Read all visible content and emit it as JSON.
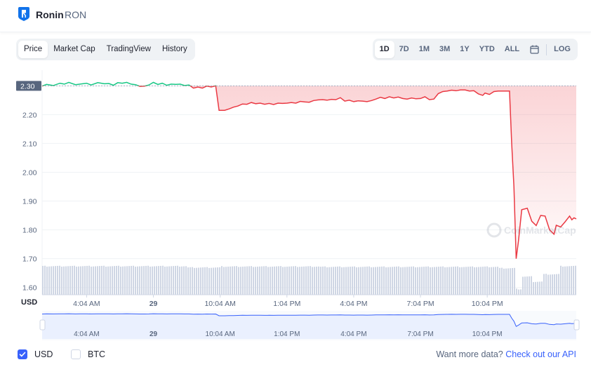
{
  "header": {
    "name": "Ronin",
    "symbol": "RON"
  },
  "tabs": [
    "Price",
    "Market Cap",
    "TradingView",
    "History"
  ],
  "ranges": [
    "1D",
    "7D",
    "1M",
    "3M",
    "1Y",
    "YTD",
    "ALL"
  ],
  "log_label": "LOG",
  "icons": {
    "logo": "ronin-logo-icon",
    "calendar": "calendar-icon",
    "check": "check-icon"
  },
  "colors": {
    "up": "#16c784",
    "down": "#ea3943",
    "accent": "#3861fb",
    "volume": "#cfd6e4"
  },
  "chart_data": {
    "type": "line",
    "ylabel": "USD",
    "y_ticks": [
      2.3,
      2.2,
      2.1,
      2.0,
      1.9,
      1.8,
      1.7,
      1.6
    ],
    "ylim": [
      1.575,
      2.33
    ],
    "x_ticks": [
      "4:04 AM",
      "29",
      "10:04 AM",
      "1:04 PM",
      "4:04 PM",
      "7:04 PM",
      "10:04 PM"
    ],
    "x_tick_hours": [
      2,
      5,
      8,
      11,
      14,
      17,
      20
    ],
    "x_range_hours": [
      0,
      24
    ],
    "reference_price": 2.3,
    "reference_label": "2.30",
    "grid": true,
    "watermark": "CoinMarketCap",
    "series": [
      {
        "values": [
          [
            0,
            2.299
          ],
          [
            0.2,
            2.305
          ],
          [
            0.5,
            2.301
          ],
          [
            0.8,
            2.309
          ],
          [
            1.0,
            2.306
          ],
          [
            1.2,
            2.312
          ],
          [
            1.5,
            2.304
          ],
          [
            1.7,
            2.306
          ],
          [
            2.0,
            2.309
          ],
          [
            2.2,
            2.303
          ],
          [
            2.5,
            2.311
          ],
          [
            2.8,
            2.307
          ],
          [
            3.0,
            2.308
          ],
          [
            3.2,
            2.302
          ],
          [
            3.4,
            2.311
          ],
          [
            3.6,
            2.309
          ],
          [
            3.8,
            2.312
          ],
          [
            4.0,
            2.306
          ],
          [
            4.2,
            2.304
          ],
          [
            4.4,
            2.298
          ],
          [
            4.6,
            2.299
          ],
          [
            4.8,
            2.303
          ],
          [
            5.0,
            2.312
          ],
          [
            5.2,
            2.305
          ],
          [
            5.4,
            2.309
          ],
          [
            5.6,
            2.302
          ],
          [
            5.8,
            2.306
          ],
          [
            6.0,
            2.305
          ],
          [
            6.2,
            2.306
          ],
          [
            6.4,
            2.301
          ],
          [
            6.6,
            2.303
          ],
          [
            6.8,
            2.292
          ],
          [
            7.0,
            2.296
          ],
          [
            7.2,
            2.292
          ],
          [
            7.4,
            2.299
          ],
          [
            7.6,
            2.296
          ],
          [
            7.8,
            2.3
          ],
          [
            7.95,
            2.215
          ],
          [
            8.2,
            2.215
          ],
          [
            8.4,
            2.22
          ],
          [
            8.6,
            2.226
          ],
          [
            8.8,
            2.23
          ],
          [
            9.0,
            2.237
          ],
          [
            9.2,
            2.236
          ],
          [
            9.4,
            2.242
          ],
          [
            9.6,
            2.238
          ],
          [
            9.8,
            2.24
          ],
          [
            10.0,
            2.236
          ],
          [
            10.2,
            2.239
          ],
          [
            10.4,
            2.235
          ],
          [
            10.6,
            2.24
          ],
          [
            10.8,
            2.239
          ],
          [
            11.0,
            2.24
          ],
          [
            11.2,
            2.242
          ],
          [
            11.4,
            2.24
          ],
          [
            11.6,
            2.246
          ],
          [
            11.8,
            2.244
          ],
          [
            12.0,
            2.243
          ],
          [
            12.2,
            2.249
          ],
          [
            12.4,
            2.251
          ],
          [
            12.6,
            2.252
          ],
          [
            12.8,
            2.25
          ],
          [
            13.0,
            2.253
          ],
          [
            13.2,
            2.252
          ],
          [
            13.4,
            2.259
          ],
          [
            13.6,
            2.247
          ],
          [
            13.8,
            2.25
          ],
          [
            14.0,
            2.245
          ],
          [
            14.2,
            2.248
          ],
          [
            14.4,
            2.247
          ],
          [
            14.6,
            2.245
          ],
          [
            14.8,
            2.249
          ],
          [
            15.0,
            2.254
          ],
          [
            15.2,
            2.26
          ],
          [
            15.4,
            2.256
          ],
          [
            15.6,
            2.262
          ],
          [
            15.8,
            2.258
          ],
          [
            16.0,
            2.261
          ],
          [
            16.2,
            2.256
          ],
          [
            16.4,
            2.254
          ],
          [
            16.6,
            2.258
          ],
          [
            16.8,
            2.255
          ],
          [
            17.0,
            2.256
          ],
          [
            17.2,
            2.262
          ],
          [
            17.4,
            2.252
          ],
          [
            17.6,
            2.254
          ],
          [
            17.8,
            2.273
          ],
          [
            18.0,
            2.28
          ],
          [
            18.2,
            2.282
          ],
          [
            18.4,
            2.285
          ],
          [
            18.6,
            2.283
          ],
          [
            18.8,
            2.286
          ],
          [
            19.0,
            2.286
          ],
          [
            19.2,
            2.282
          ],
          [
            19.4,
            2.283
          ],
          [
            19.6,
            2.272
          ],
          [
            19.8,
            2.267
          ],
          [
            19.9,
            2.275
          ],
          [
            20.1,
            2.27
          ],
          [
            20.3,
            2.28
          ],
          [
            20.5,
            2.282
          ],
          [
            20.7,
            2.282
          ],
          [
            21.0,
            2.282
          ],
          [
            21.1,
            2.1
          ],
          [
            21.2,
            1.95
          ],
          [
            21.3,
            1.7
          ],
          [
            21.4,
            1.76
          ],
          [
            21.55,
            1.87
          ],
          [
            21.8,
            1.875
          ],
          [
            22.0,
            1.83
          ],
          [
            22.2,
            1.815
          ],
          [
            22.4,
            1.85
          ],
          [
            22.6,
            1.848
          ],
          [
            22.8,
            1.8
          ],
          [
            23.0,
            1.785
          ],
          [
            23.1,
            1.816
          ],
          [
            23.3,
            1.81
          ],
          [
            23.5,
            1.828
          ],
          [
            23.7,
            1.848
          ],
          [
            23.8,
            1.835
          ],
          [
            23.9,
            1.842
          ],
          [
            24.0,
            1.838
          ]
        ]
      }
    ],
    "volume": [
      {
        "from": 0,
        "to": 6.5,
        "level": 0.86
      },
      {
        "from": 6.5,
        "to": 8.0,
        "level": 0.82
      },
      {
        "from": 8.0,
        "to": 12.4,
        "level": 0.85
      },
      {
        "from": 12.4,
        "to": 20.5,
        "level": 0.84
      },
      {
        "from": 20.5,
        "to": 21.2,
        "level": 0.8
      },
      {
        "from": 21.2,
        "to": 21.5,
        "level": 0.18
      },
      {
        "from": 21.5,
        "to": 22.0,
        "level": 0.55
      },
      {
        "from": 22.0,
        "to": 22.5,
        "level": 0.4
      },
      {
        "from": 22.5,
        "to": 23.2,
        "level": 0.62
      },
      {
        "from": 23.2,
        "to": 24.0,
        "level": 0.86
      }
    ]
  },
  "bottom": {
    "usd_label": "USD",
    "btc_label": "BTC",
    "more_text": "Want more data?",
    "api_link": "Check out our API"
  }
}
